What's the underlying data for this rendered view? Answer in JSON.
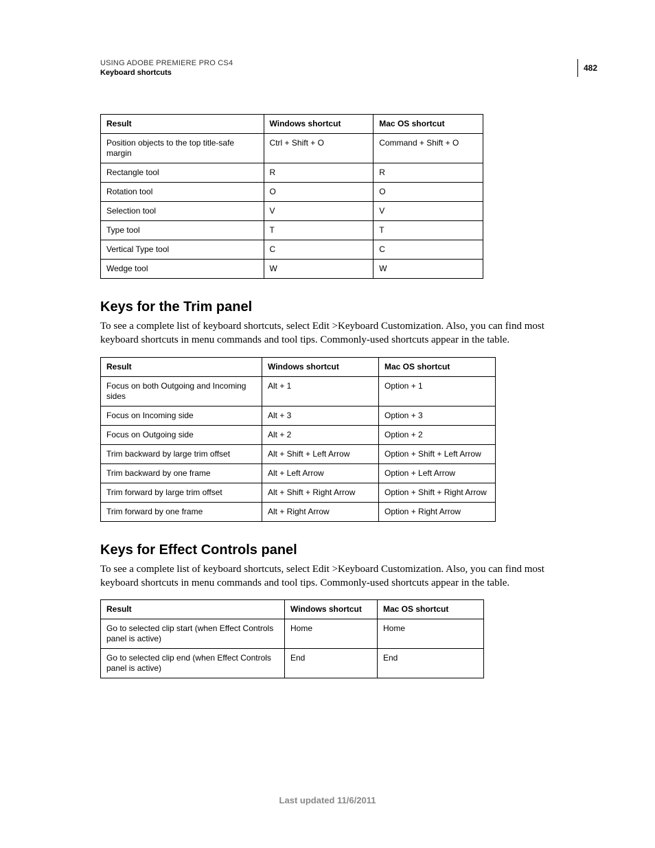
{
  "header": {
    "running_head": "USING ADOBE PREMIERE PRO CS4",
    "running_sub": "Keyboard shortcuts",
    "page_number": "482"
  },
  "table1": {
    "headers": {
      "result": "Result",
      "win": "Windows shortcut",
      "mac": "Mac OS shortcut"
    },
    "rows": [
      {
        "result": "Position objects to the top title-safe margin",
        "win": "Ctrl + Shift + O",
        "mac": "Command + Shift + O"
      },
      {
        "result": "Rectangle tool",
        "win": "R",
        "mac": "R"
      },
      {
        "result": "Rotation tool",
        "win": "O",
        "mac": "O"
      },
      {
        "result": "Selection tool",
        "win": "V",
        "mac": "V"
      },
      {
        "result": "Type tool",
        "win": "T",
        "mac": "T"
      },
      {
        "result": "Vertical Type tool",
        "win": "C",
        "mac": "C"
      },
      {
        "result": "Wedge tool",
        "win": "W",
        "mac": "W"
      }
    ]
  },
  "section_trim": {
    "title": "Keys for the Trim panel",
    "intro": "To see a complete list of keyboard shortcuts, select Edit >Keyboard Customization. Also, you can find most keyboard shortcuts in menu commands and tool tips. Commonly-used shortcuts appear in the table."
  },
  "table2": {
    "headers": {
      "result": "Result",
      "win": "Windows shortcut",
      "mac": "Mac OS shortcut"
    },
    "rows": [
      {
        "result": "Focus on both Outgoing and Incoming sides",
        "win": "Alt + 1",
        "mac": "Option + 1"
      },
      {
        "result": "Focus on Incoming side",
        "win": "Alt + 3",
        "mac": "Option + 3"
      },
      {
        "result": "Focus on Outgoing side",
        "win": "Alt + 2",
        "mac": "Option + 2"
      },
      {
        "result": "Trim backward by large trim offset",
        "win": "Alt + Shift + Left Arrow",
        "mac": "Option + Shift + Left Arrow"
      },
      {
        "result": "Trim backward by one frame",
        "win": "Alt + Left Arrow",
        "mac": "Option + Left Arrow"
      },
      {
        "result": "Trim forward by large trim offset",
        "win": "Alt + Shift + Right Arrow",
        "mac": "Option + Shift + Right Arrow"
      },
      {
        "result": "Trim forward by one frame",
        "win": "Alt + Right Arrow",
        "mac": "Option + Right Arrow"
      }
    ]
  },
  "section_effect": {
    "title": "Keys for Effect Controls panel",
    "intro": "To see a complete list of keyboard shortcuts, select Edit >Keyboard Customization. Also, you can find most keyboard shortcuts in menu commands and tool tips. Commonly-used shortcuts appear in the table."
  },
  "table3": {
    "headers": {
      "result": "Result",
      "win": "Windows shortcut",
      "mac": "Mac OS shortcut"
    },
    "rows": [
      {
        "result": "Go to selected clip start (when Effect Controls panel is active)",
        "win": "Home",
        "mac": "Home"
      },
      {
        "result": "Go to selected clip end (when Effect Controls panel is active)",
        "win": "End",
        "mac": "End"
      }
    ]
  },
  "footer": {
    "last_updated": "Last updated 11/6/2011"
  }
}
